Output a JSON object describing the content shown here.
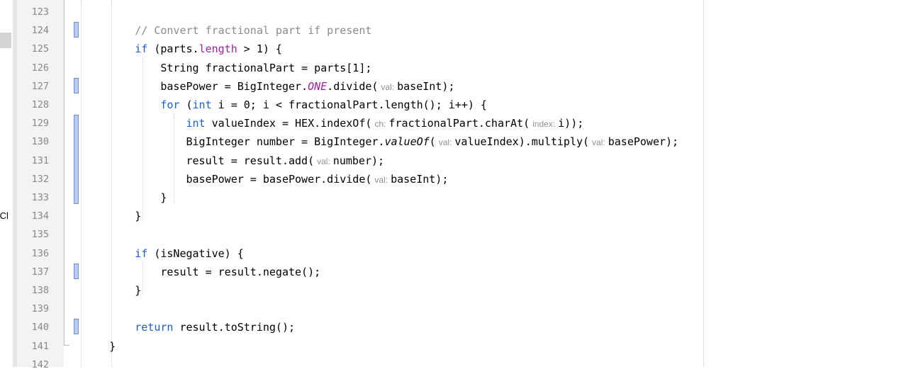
{
  "side_panel": {
    "clipped_text": "/Cl"
  },
  "line_numbers": [
    "123",
    "124",
    "125",
    "126",
    "127",
    "128",
    "129",
    "130",
    "131",
    "132",
    "133",
    "134",
    "135",
    "136",
    "137",
    "138",
    "139",
    "140",
    "141",
    "142"
  ],
  "code_lines": [
    {
      "segs": []
    },
    {
      "segs": [
        {
          "t": "        "
        },
        {
          "t": "// Convert fractional part if present",
          "c": "cmt"
        }
      ]
    },
    {
      "segs": [
        {
          "t": "        "
        },
        {
          "t": "if",
          "c": "kw"
        },
        {
          "t": " (parts."
        },
        {
          "t": "length",
          "c": "fld"
        },
        {
          "t": " > 1) {"
        }
      ]
    },
    {
      "segs": [
        {
          "t": "            String fractionalPart = parts[1];"
        }
      ]
    },
    {
      "segs": [
        {
          "t": "            basePower = BigInteger."
        },
        {
          "t": "ONE",
          "c": "cnst"
        },
        {
          "t": ".divide("
        },
        {
          "t": "val:",
          "c": "hint"
        },
        {
          "t": "baseInt);"
        }
      ]
    },
    {
      "segs": [
        {
          "t": "            "
        },
        {
          "t": "for",
          "c": "kw"
        },
        {
          "t": " ("
        },
        {
          "t": "int",
          "c": "kw"
        },
        {
          "t": " i = 0; i < fractionalPart.length(); i++) {"
        }
      ]
    },
    {
      "segs": [
        {
          "t": "                "
        },
        {
          "t": "int",
          "c": "kw"
        },
        {
          "t": " valueIndex = HEX.indexOf("
        },
        {
          "t": "ch:",
          "c": "hint"
        },
        {
          "t": "fractionalPart.charAt("
        },
        {
          "t": "index:",
          "c": "hint"
        },
        {
          "t": "i));"
        }
      ]
    },
    {
      "segs": [
        {
          "t": "                BigInteger number = BigInteger."
        },
        {
          "t": "valueOf",
          "c": "st"
        },
        {
          "t": "("
        },
        {
          "t": "val:",
          "c": "hint"
        },
        {
          "t": "valueIndex).multiply("
        },
        {
          "t": "val:",
          "c": "hint"
        },
        {
          "t": "basePower);"
        }
      ]
    },
    {
      "segs": [
        {
          "t": "                result = result.add("
        },
        {
          "t": "val:",
          "c": "hint"
        },
        {
          "t": "number);"
        }
      ]
    },
    {
      "segs": [
        {
          "t": "                basePower = basePower.divide("
        },
        {
          "t": "val:",
          "c": "hint"
        },
        {
          "t": "baseInt);"
        }
      ]
    },
    {
      "segs": [
        {
          "t": "            }"
        }
      ]
    },
    {
      "segs": [
        {
          "t": "        }"
        }
      ]
    },
    {
      "segs": []
    },
    {
      "segs": [
        {
          "t": "        "
        },
        {
          "t": "if",
          "c": "kw"
        },
        {
          "t": " (isNegative) {"
        }
      ]
    },
    {
      "segs": [
        {
          "t": "            result = result.negate();"
        }
      ]
    },
    {
      "segs": [
        {
          "t": "        }"
        }
      ]
    },
    {
      "segs": []
    },
    {
      "segs": [
        {
          "t": "        "
        },
        {
          "t": "return",
          "c": "kw"
        },
        {
          "t": " result.toString();"
        }
      ]
    },
    {
      "segs": [
        {
          "t": "    }"
        }
      ]
    },
    {
      "segs": []
    }
  ]
}
